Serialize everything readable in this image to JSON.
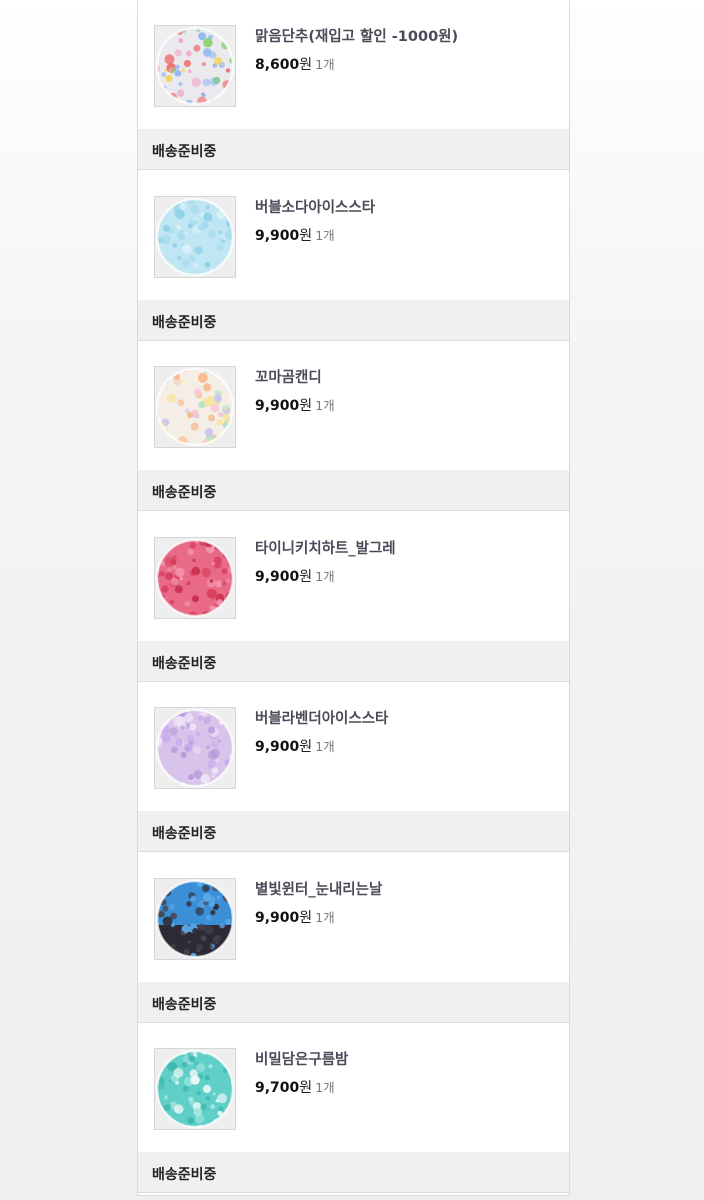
{
  "orders": [
    {
      "name": "맑음단추(재입고 할인 -1000원)",
      "price": "8,600",
      "currency": "원",
      "quantity": "1개",
      "status": "배송준비중",
      "thumb_colors": [
        "#e9e9ee",
        "#f26b6b",
        "#f5d34a",
        "#8fd17a",
        "#8db6f0",
        "#f0a3c8"
      ]
    },
    {
      "name": "버블소다아이스스타",
      "price": "9,900",
      "currency": "원",
      "quantity": "1개",
      "status": "배송준비중",
      "thumb_colors": [
        "#bfe6f2",
        "#8fd0e8",
        "#d9f2f8",
        "#a6dcee"
      ]
    },
    {
      "name": "꼬마곰캔디",
      "price": "9,900",
      "currency": "원",
      "quantity": "1개",
      "status": "배송준비중",
      "thumb_colors": [
        "#f5eee6",
        "#f5c6d6",
        "#f7e38a",
        "#b9e3c6",
        "#c9c3ee",
        "#f6b98a"
      ]
    },
    {
      "name": "타이니키치하트_발그레",
      "price": "9,900",
      "currency": "원",
      "quantity": "1개",
      "status": "배송준비중",
      "thumb_colors": [
        "#e86a86",
        "#d9405f",
        "#f29ab0",
        "#c8304e"
      ]
    },
    {
      "name": "버블라벤더아이스스타",
      "price": "9,900",
      "currency": "원",
      "quantity": "1개",
      "status": "배송준비중",
      "thumb_colors": [
        "#d8c4ea",
        "#b79ad9",
        "#efe4f7",
        "#c9acec"
      ]
    },
    {
      "name": "별빛윈터_눈내리는날",
      "price": "9,900",
      "currency": "원",
      "quantity": "1개",
      "status": "배송준비중",
      "thumb_colors": [
        "#3b8fd6",
        "#5aa8e6",
        "#4a4550",
        "#2d2a33"
      ]
    },
    {
      "name": "비밀담은구름밤",
      "price": "9,700",
      "currency": "원",
      "quantity": "1개",
      "status": "배송준비중",
      "thumb_colors": [
        "#5fcfc7",
        "#3fb9b3",
        "#a7e6e1",
        "#e9f7f6"
      ]
    }
  ]
}
